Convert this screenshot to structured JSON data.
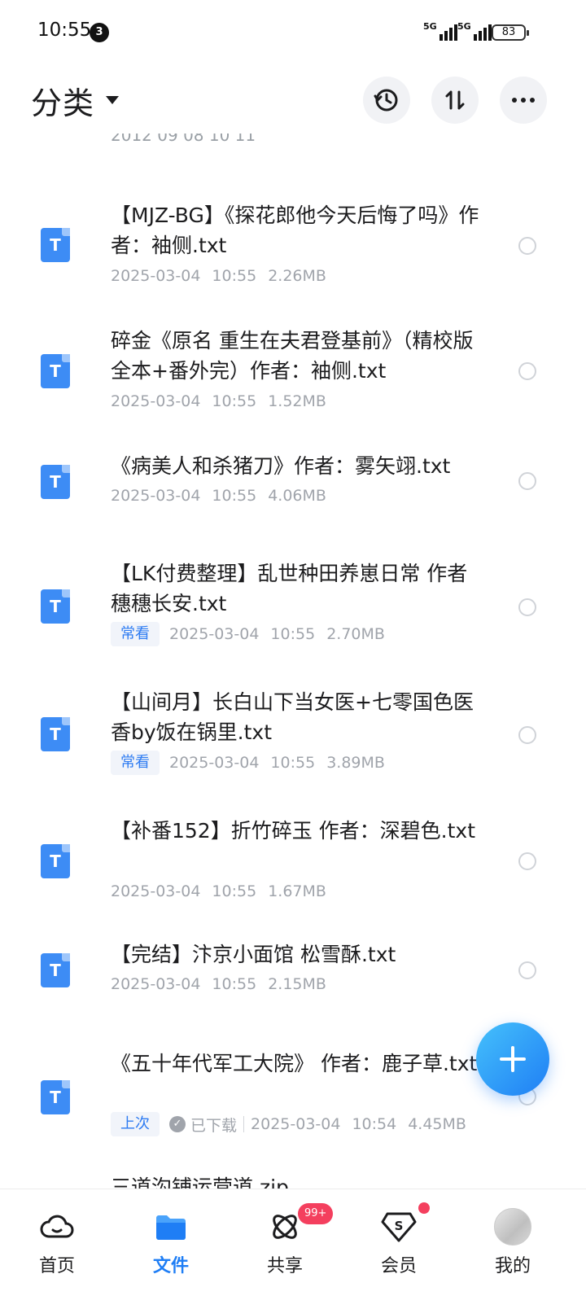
{
  "status_bar": {
    "time": "10:55",
    "notification_count": "3",
    "signal_1": "5G",
    "signal_2": "5G",
    "battery": "83"
  },
  "header": {
    "title": "分类",
    "buttons": [
      "history-icon",
      "sort-icon",
      "more-icon"
    ]
  },
  "list": {
    "partial_top_item": "2012 09 08 10 11",
    "partial_bottom_item": "三道沟铺运营道.zip",
    "files": [
      {
        "title": "【MJZ-BG】《探花郎他今天后悔了吗》作者：袖侧.txt",
        "date": "2025-03-04",
        "time": "10:55",
        "size": "2.26MB",
        "tag": "",
        "downloaded": ""
      },
      {
        "title": "碎金《原名 重生在夫君登基前》（精校版全本+番外完）作者：袖侧.txt",
        "date": "2025-03-04",
        "time": "10:55",
        "size": "1.52MB",
        "tag": "",
        "downloaded": ""
      },
      {
        "title": "《病美人和杀猪刀》作者：雾矢翊.txt",
        "date": "2025-03-04",
        "time": "10:55",
        "size": "4.06MB",
        "tag": "",
        "downloaded": ""
      },
      {
        "title": "【LK付费整理】乱世种田养崽日常 作者 穗穗长安.txt",
        "date": "2025-03-04",
        "time": "10:55",
        "size": "2.70MB",
        "tag": "常看",
        "downloaded": ""
      },
      {
        "title": "【山间月】长白山下当女医+七零国色医香by饭在锅里.txt",
        "date": "2025-03-04",
        "time": "10:55",
        "size": "3.89MB",
        "tag": "常看",
        "downloaded": ""
      },
      {
        "title": "【补番152】折竹碎玉 作者：深碧色.txt",
        "date": "2025-03-04",
        "time": "10:55",
        "size": "1.67MB",
        "tag": "",
        "downloaded": ""
      },
      {
        "title": "【完结】汴京小面馆 松雪酥.txt",
        "date": "2025-03-04",
        "time": "10:55",
        "size": "2.15MB",
        "tag": "",
        "downloaded": ""
      },
      {
        "title": "《五十年代军工大院》 作者：鹿子草.txt",
        "date": "2025-03-04",
        "time": "10:54",
        "size": "4.45MB",
        "tag": "上次",
        "downloaded": "已下载"
      }
    ],
    "file_icon_letter": "T"
  },
  "fab": {
    "icon": "plus-icon"
  },
  "bottom_nav": {
    "items": [
      {
        "label": "首页",
        "icon": "cloud-icon"
      },
      {
        "label": "文件",
        "icon": "folder-icon"
      },
      {
        "label": "共享",
        "icon": "share-atom-icon"
      },
      {
        "label": "会员",
        "icon": "vip-diamond-icon"
      },
      {
        "label": "我的",
        "icon": "avatar"
      }
    ],
    "share_badge": "99+",
    "active_color": "#1f7ef5"
  }
}
